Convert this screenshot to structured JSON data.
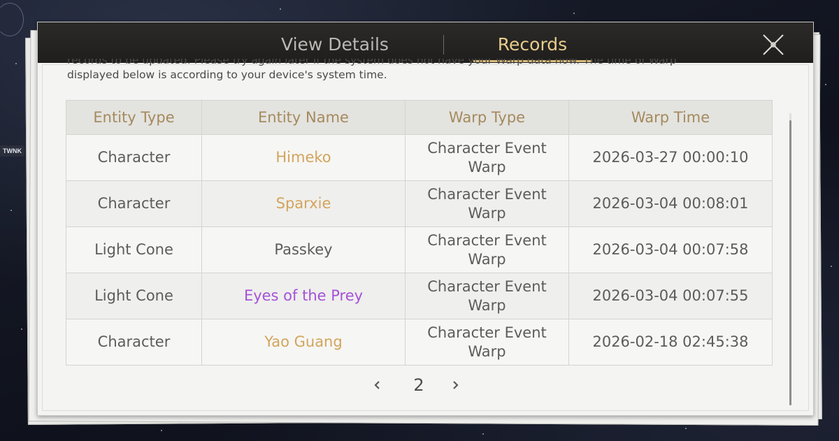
{
  "background": {
    "side_badge": "TWNK"
  },
  "tabs": [
    {
      "label": "View Details",
      "active": false
    },
    {
      "label": "Records",
      "active": true
    }
  ],
  "notice": {
    "line1": "records to be updated. Please try again later if the system does not have your Warp data now. The time of Warp",
    "line2": "displayed below is according to your device's system time."
  },
  "table": {
    "columns": [
      "Entity Type",
      "Entity Name",
      "Warp Type",
      "Warp Time"
    ],
    "rows": [
      {
        "entity_type": "Character",
        "entity_name": "Himeko",
        "warp_type": "Character Event Warp",
        "warp_time": "2026-03-27 00:00:10",
        "name_color": "#d3a45c"
      },
      {
        "entity_type": "Character",
        "entity_name": "Sparxie",
        "warp_type": "Character Event Warp",
        "warp_time": "2026-03-04 00:08:01",
        "name_color": "#d3a45c"
      },
      {
        "entity_type": "Light Cone",
        "entity_name": "Passkey",
        "warp_type": "Character Event Warp",
        "warp_time": "2026-03-04 00:07:58",
        "name_color": "#5c5c5a"
      },
      {
        "entity_type": "Light Cone",
        "entity_name": "Eyes of the Prey",
        "warp_type": "Character Event Warp",
        "warp_time": "2026-03-04 00:07:55",
        "name_color": "#a552d8"
      },
      {
        "entity_type": "Character",
        "entity_name": "Yao Guang",
        "warp_type": "Character Event Warp",
        "warp_time": "2026-02-18 02:45:38",
        "name_color": "#d3a45c"
      }
    ]
  },
  "pagination": {
    "current_page": "2",
    "prev_icon": "chevron-left-icon",
    "next_icon": "chevron-right-icon"
  },
  "close_icon": "close-icon",
  "colors": {
    "accent_gold": "#e8cc8c",
    "header_text": "#a58a5c",
    "five_star": "#d3a45c",
    "four_star": "#a552d8",
    "three_star": "#5c5c5a"
  }
}
